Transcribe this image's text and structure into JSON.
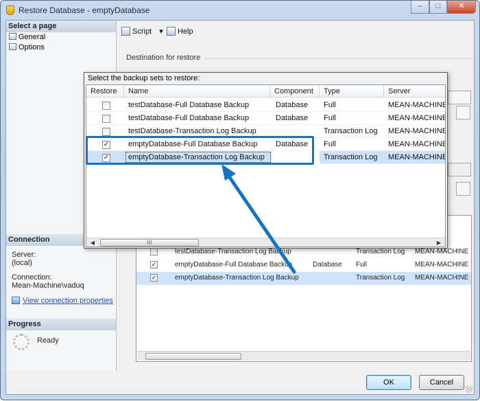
{
  "window": {
    "title": "Restore Database - emptyDatabase",
    "controls": {
      "minimize": "–",
      "maximize": "□",
      "close": "✕"
    }
  },
  "left_pane": {
    "select_page_header": "Select a page",
    "pages": [
      "General",
      "Options"
    ],
    "connection_header": "Connection",
    "server_label": "Server:",
    "server_value": "(local)",
    "connection_label": "Connection:",
    "connection_value": "Mean-Machine\\vaduq",
    "view_connection_link": "View connection properties",
    "progress_header": "Progress",
    "progress_status": "Ready"
  },
  "toolbar": {
    "script_label": "Script",
    "script_dropdown": "▾",
    "help_label": "Help"
  },
  "destination_label": "Destination for restore",
  "backup_popup": {
    "title": "Select the backup sets to restore:",
    "columns": [
      "Restore",
      "Name",
      "Component",
      "Type",
      "Server"
    ],
    "rows": [
      {
        "restore": false,
        "check_mark": "",
        "name": "testDatabase-Full Database Backup",
        "component": "Database",
        "type": "Full",
        "server": "MEAN-MACHINE"
      },
      {
        "restore": false,
        "check_mark": "",
        "name": "testDatabase-Full Database Backup",
        "component": "Database",
        "type": "Full",
        "server": "MEAN-MACHINE"
      },
      {
        "restore": false,
        "check_mark": "",
        "name": "testDatabase-Transaction Log  Backup",
        "component": "",
        "type": "Transaction Log",
        "server": "MEAN-MACHINE"
      },
      {
        "restore": true,
        "check_mark": "✓",
        "name": "emptyDatabase-Full Database Backup",
        "component": "Database",
        "type": "Full",
        "server": "MEAN-MACHINE"
      },
      {
        "restore": true,
        "check_mark": "✓",
        "name": "emptyDatabase-Transaction Log  Backup",
        "component": "",
        "type": "Transaction Log",
        "server": "MEAN-MACHINE"
      }
    ],
    "scroll": {
      "left": "◀",
      "right": "▶",
      "thumb_grip": "III"
    }
  },
  "background_grid": {
    "rows": [
      {
        "check_mark": "",
        "name": "testDatabase-Transaction Log  Backup",
        "component": "",
        "type": "Transaction Log",
        "server": "MEAN-MACHINE"
      },
      {
        "check_mark": "✓",
        "name": "emptyDatabase-Full Database Backup",
        "component": "Database",
        "type": "Full",
        "server": "MEAN-MACHINE"
      },
      {
        "check_mark": "✓",
        "name": "emptyDatabase-Transaction Log  Backup",
        "component": "",
        "type": "Transaction Log",
        "server": "MEAN-MACHINE"
      }
    ]
  },
  "buttons": {
    "ok": "OK",
    "cancel": "Cancel"
  },
  "colors": {
    "highlight": "#1373c6",
    "selection": "#cce2f8"
  }
}
